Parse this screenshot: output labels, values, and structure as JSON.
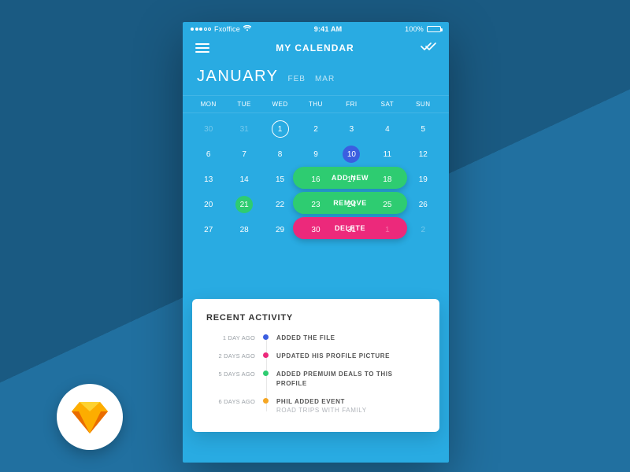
{
  "statusbar": {
    "carrier": "Fxoffice",
    "time": "9:41 AM",
    "battery": "100%"
  },
  "navbar": {
    "title": "MY CALENDAR"
  },
  "months": {
    "current": "JANUARY",
    "next1": "FEB",
    "next2": "MAR"
  },
  "weekdays": [
    "MON",
    "TUE",
    "WED",
    "THU",
    "FRI",
    "SAT",
    "SUN"
  ],
  "calendar": {
    "rows": [
      [
        {
          "n": "30",
          "faded": true
        },
        {
          "n": "31",
          "faded": true
        },
        {
          "n": "1",
          "style": "outline"
        },
        {
          "n": "2"
        },
        {
          "n": "3"
        },
        {
          "n": "4"
        },
        {
          "n": "5"
        }
      ],
      [
        {
          "n": "6"
        },
        {
          "n": "7"
        },
        {
          "n": "8"
        },
        {
          "n": "9"
        },
        {
          "n": "10",
          "style": "blue"
        },
        {
          "n": "11"
        },
        {
          "n": "12"
        }
      ],
      [
        {
          "n": "13"
        },
        {
          "n": "14"
        },
        {
          "n": "15"
        },
        {
          "n": "16"
        },
        {
          "n": "17"
        },
        {
          "n": "18"
        },
        {
          "n": "19"
        }
      ],
      [
        {
          "n": "20"
        },
        {
          "n": "21",
          "style": "green"
        },
        {
          "n": "22"
        },
        {
          "n": "23"
        },
        {
          "n": "24"
        },
        {
          "n": "25"
        },
        {
          "n": "26"
        }
      ],
      [
        {
          "n": "27"
        },
        {
          "n": "28"
        },
        {
          "n": "29"
        },
        {
          "n": "30"
        },
        {
          "n": "31"
        },
        {
          "n": "1",
          "faded": true
        },
        {
          "n": "2",
          "faded": true
        }
      ]
    ]
  },
  "actions": {
    "add": "ADD NEW",
    "remove": "REMOVE",
    "delete": "DELETE"
  },
  "recent": {
    "heading": "RECENT ACTIVITY",
    "items": [
      {
        "time": "1 DAY AGO",
        "color": "#3b5ee0",
        "text": "ADDED THE FILE",
        "sub": ""
      },
      {
        "time": "2 DAYS AGO",
        "color": "#ec297b",
        "text": "UPDATED HIS PROFILE PICTURE",
        "sub": ""
      },
      {
        "time": "5 DAYS AGO",
        "color": "#2ecc71",
        "text": "ADDED PREMUIM DEALS TO THIS PROFILE",
        "sub": ""
      },
      {
        "time": "6 DAYS AGO",
        "color": "#f5a623",
        "text": "PHIL ADDED EVENT",
        "sub": "ROAD TRIPS WITH FAMILY"
      }
    ]
  }
}
